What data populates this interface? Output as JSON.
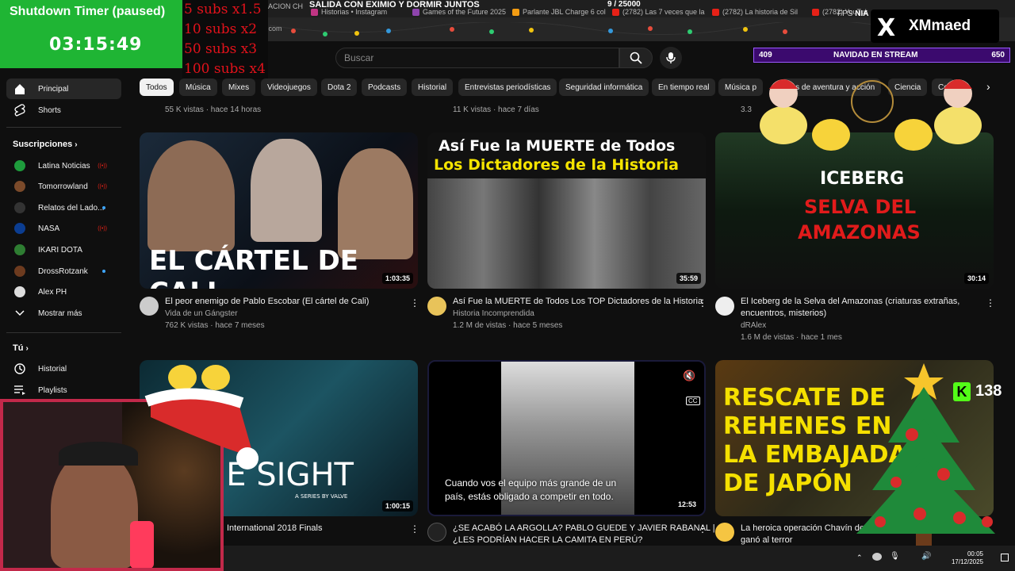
{
  "browser": {
    "stream_title": "SALIDA CON EXIMIO Y DORMIR JUNTOS",
    "sub_goal": "9 / 25000",
    "tabs": [
      "ACION CH",
      "Historias • Instagram",
      "Games of the Future 2025",
      "Parlante JBL Charge 6 col",
      "(2782) Las 7 veces que la",
      "(2782) La historia de Sil",
      "(2782) YouTube"
    ],
    "url_fragment": ".com"
  },
  "overlay": {
    "timer_title": "Shutdown Timer (paused)",
    "timer_value": "03:15:49",
    "subs_multipliers": [
      "5 subs x1.5",
      "10 subs x2",
      "50 subs x3",
      "100 subs x4"
    ],
    "brand_x": "X",
    "brand_name": "XMmaed",
    "navidad_left": "409",
    "navidad_title": "NAVIDAD EN STREAM",
    "navidad_right": "650",
    "kick_count": "138",
    "kick_letter": "K",
    "fps_label": "FPS",
    "fps_fragment": "NIA"
  },
  "header": {
    "search_placeholder": "Buscar"
  },
  "sidebar": {
    "main": [
      {
        "label": "Principal"
      },
      {
        "label": "Shorts"
      }
    ],
    "subscriptions_title": "Suscripciones",
    "subscriptions": [
      {
        "label": "Latina Noticias",
        "status": "live",
        "color": "#1e9c3c"
      },
      {
        "label": "Tomorrowland",
        "status": "live",
        "color": "#7b4a2a"
      },
      {
        "label": "Relatos del Lado...",
        "status": "new",
        "color": "#333333"
      },
      {
        "label": "NASA",
        "status": "live",
        "color": "#0b3d91"
      },
      {
        "label": "IKARI DOTA",
        "status": "",
        "color": "#2e7d32"
      },
      {
        "label": "DrossRotzank",
        "status": "new",
        "color": "#6d3b1f"
      },
      {
        "label": "Alex PH",
        "status": "",
        "color": "#dddddd"
      }
    ],
    "show_more": "Mostrar más",
    "you_title": "Tú",
    "you_items": [
      {
        "label": "Historial"
      },
      {
        "label": "Playlists"
      }
    ]
  },
  "chips": [
    "Todos",
    "Música",
    "Mixes",
    "Videojuegos",
    "Dota 2",
    "Podcasts",
    "Historial",
    "Entrevistas periodísticas",
    "Seguridad informática",
    "En tiempo real",
    "Música p",
    "gos de aventura y acción",
    "Ciencia",
    "Co"
  ],
  "previous_row_meta": [
    "55 K vistas · hace 14 horas",
    "11 K vistas · hace 7 días",
    "3.3"
  ],
  "videos": [
    {
      "thumb_text": "EL CÁRTEL DE CALI",
      "duration": "1:03:35",
      "title": "El peor enemigo de Pablo Escobar (El cártel de Cali)",
      "channel": "Vida de un Gángster",
      "meta": "762 K vistas · hace 7 meses"
    },
    {
      "thumb_line1": "Así Fue la MUERTE de Todos",
      "thumb_line2": "Los Dictadores de la Historia",
      "duration": "35:59",
      "title": "Así Fue la MUERTE de Todos Los TOP Dictadores de la Historia",
      "channel": "Historia Incomprendida",
      "meta": "1.2 M de vistas · hace 5 meses"
    },
    {
      "thumb_line1": "ICEBERG",
      "thumb_line2": "SELVA DEL",
      "thumb_line3": "AMAZONAS",
      "duration": "30:14",
      "title_line1": "El Iceberg de la Selva del Amazonas (criaturas extrañas,",
      "title_line2": "encuentros, misterios)",
      "channel": "dRAlex",
      "meta": "1.6 M de vistas · hace 1 mes"
    },
    {
      "thumb_text": "UE SIGHT",
      "thumb_sub": "A SERIES BY VALVE",
      "duration": "1:00:15",
      "title": "International 2018 Finals"
    },
    {
      "caption_line1": "Cuando vos el equipo más grande de un",
      "caption_line2": "país, estás obligado a competir en todo.",
      "duration": "12:53",
      "title_line1": "¿SE ACABÓ LA ARGOLLA? PABLO GUEDE Y JAVIER RABANAL |",
      "title_line2": "¿LES PODRÍAN HACER LA CAMITA EN PERÚ?",
      "cc": "CC"
    },
    {
      "thumb_line1": "RESCATE DE",
      "thumb_line2": "REHENES EN",
      "thumb_line3": "LA EMBAJADA",
      "thumb_line4": "DE JAPÓN",
      "duration": "",
      "title_line1": "La heroica operación Chavín de Hu",
      "title_line2": "ganó al terror",
      "title_tail": "Pe"
    }
  ],
  "taskbar": {
    "time": "00:05",
    "date": "17/12/2025"
  }
}
